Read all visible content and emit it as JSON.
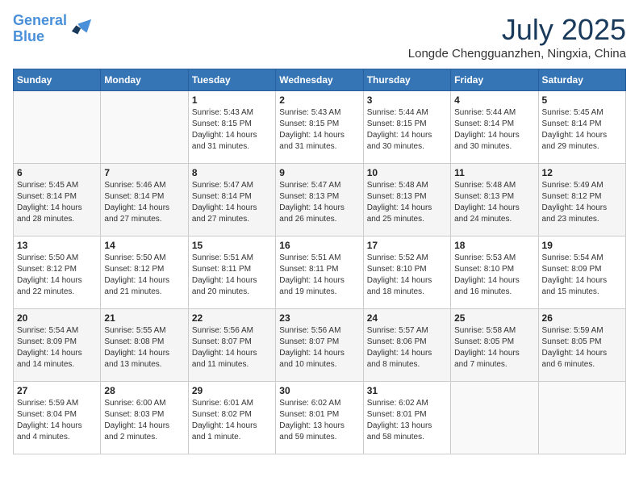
{
  "header": {
    "logo_line1": "General",
    "logo_line2": "Blue",
    "month": "July 2025",
    "location": "Longde Chengguanzhen, Ningxia, China"
  },
  "weekdays": [
    "Sunday",
    "Monday",
    "Tuesday",
    "Wednesday",
    "Thursday",
    "Friday",
    "Saturday"
  ],
  "weeks": [
    [
      {
        "day": "",
        "info": ""
      },
      {
        "day": "",
        "info": ""
      },
      {
        "day": "1",
        "info": "Sunrise: 5:43 AM\nSunset: 8:15 PM\nDaylight: 14 hours and 31 minutes."
      },
      {
        "day": "2",
        "info": "Sunrise: 5:43 AM\nSunset: 8:15 PM\nDaylight: 14 hours and 31 minutes."
      },
      {
        "day": "3",
        "info": "Sunrise: 5:44 AM\nSunset: 8:15 PM\nDaylight: 14 hours and 30 minutes."
      },
      {
        "day": "4",
        "info": "Sunrise: 5:44 AM\nSunset: 8:14 PM\nDaylight: 14 hours and 30 minutes."
      },
      {
        "day": "5",
        "info": "Sunrise: 5:45 AM\nSunset: 8:14 PM\nDaylight: 14 hours and 29 minutes."
      }
    ],
    [
      {
        "day": "6",
        "info": "Sunrise: 5:45 AM\nSunset: 8:14 PM\nDaylight: 14 hours and 28 minutes."
      },
      {
        "day": "7",
        "info": "Sunrise: 5:46 AM\nSunset: 8:14 PM\nDaylight: 14 hours and 27 minutes."
      },
      {
        "day": "8",
        "info": "Sunrise: 5:47 AM\nSunset: 8:14 PM\nDaylight: 14 hours and 27 minutes."
      },
      {
        "day": "9",
        "info": "Sunrise: 5:47 AM\nSunset: 8:13 PM\nDaylight: 14 hours and 26 minutes."
      },
      {
        "day": "10",
        "info": "Sunrise: 5:48 AM\nSunset: 8:13 PM\nDaylight: 14 hours and 25 minutes."
      },
      {
        "day": "11",
        "info": "Sunrise: 5:48 AM\nSunset: 8:13 PM\nDaylight: 14 hours and 24 minutes."
      },
      {
        "day": "12",
        "info": "Sunrise: 5:49 AM\nSunset: 8:12 PM\nDaylight: 14 hours and 23 minutes."
      }
    ],
    [
      {
        "day": "13",
        "info": "Sunrise: 5:50 AM\nSunset: 8:12 PM\nDaylight: 14 hours and 22 minutes."
      },
      {
        "day": "14",
        "info": "Sunrise: 5:50 AM\nSunset: 8:12 PM\nDaylight: 14 hours and 21 minutes."
      },
      {
        "day": "15",
        "info": "Sunrise: 5:51 AM\nSunset: 8:11 PM\nDaylight: 14 hours and 20 minutes."
      },
      {
        "day": "16",
        "info": "Sunrise: 5:51 AM\nSunset: 8:11 PM\nDaylight: 14 hours and 19 minutes."
      },
      {
        "day": "17",
        "info": "Sunrise: 5:52 AM\nSunset: 8:10 PM\nDaylight: 14 hours and 18 minutes."
      },
      {
        "day": "18",
        "info": "Sunrise: 5:53 AM\nSunset: 8:10 PM\nDaylight: 14 hours and 16 minutes."
      },
      {
        "day": "19",
        "info": "Sunrise: 5:54 AM\nSunset: 8:09 PM\nDaylight: 14 hours and 15 minutes."
      }
    ],
    [
      {
        "day": "20",
        "info": "Sunrise: 5:54 AM\nSunset: 8:09 PM\nDaylight: 14 hours and 14 minutes."
      },
      {
        "day": "21",
        "info": "Sunrise: 5:55 AM\nSunset: 8:08 PM\nDaylight: 14 hours and 13 minutes."
      },
      {
        "day": "22",
        "info": "Sunrise: 5:56 AM\nSunset: 8:07 PM\nDaylight: 14 hours and 11 minutes."
      },
      {
        "day": "23",
        "info": "Sunrise: 5:56 AM\nSunset: 8:07 PM\nDaylight: 14 hours and 10 minutes."
      },
      {
        "day": "24",
        "info": "Sunrise: 5:57 AM\nSunset: 8:06 PM\nDaylight: 14 hours and 8 minutes."
      },
      {
        "day": "25",
        "info": "Sunrise: 5:58 AM\nSunset: 8:05 PM\nDaylight: 14 hours and 7 minutes."
      },
      {
        "day": "26",
        "info": "Sunrise: 5:59 AM\nSunset: 8:05 PM\nDaylight: 14 hours and 6 minutes."
      }
    ],
    [
      {
        "day": "27",
        "info": "Sunrise: 5:59 AM\nSunset: 8:04 PM\nDaylight: 14 hours and 4 minutes."
      },
      {
        "day": "28",
        "info": "Sunrise: 6:00 AM\nSunset: 8:03 PM\nDaylight: 14 hours and 2 minutes."
      },
      {
        "day": "29",
        "info": "Sunrise: 6:01 AM\nSunset: 8:02 PM\nDaylight: 14 hours and 1 minute."
      },
      {
        "day": "30",
        "info": "Sunrise: 6:02 AM\nSunset: 8:01 PM\nDaylight: 13 hours and 59 minutes."
      },
      {
        "day": "31",
        "info": "Sunrise: 6:02 AM\nSunset: 8:01 PM\nDaylight: 13 hours and 58 minutes."
      },
      {
        "day": "",
        "info": ""
      },
      {
        "day": "",
        "info": ""
      }
    ]
  ]
}
